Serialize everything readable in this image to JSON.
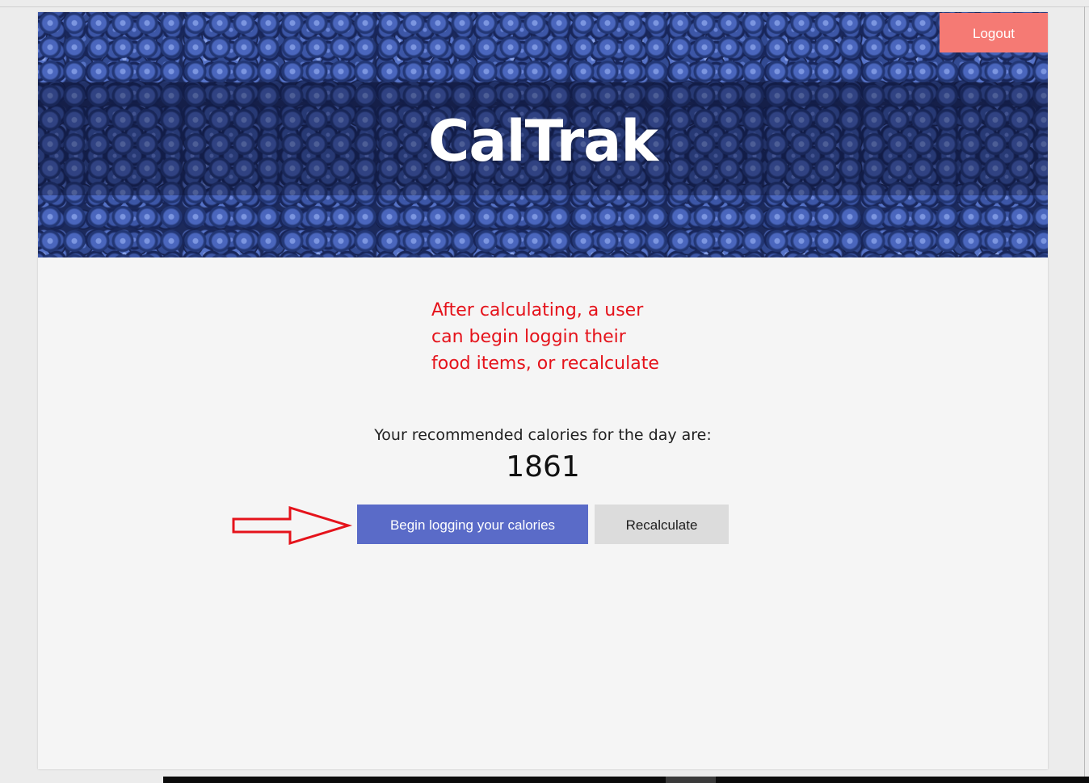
{
  "header": {
    "title": "CalTrak",
    "logout_label": "Logout"
  },
  "annotation": {
    "lines": [
      "After calculating, a user",
      "can begin loggin their",
      "food items, or recalculate"
    ],
    "color": "#e5131b"
  },
  "main": {
    "recommended_label": "Your recommended calories for the day are:",
    "recommended_value": "1861",
    "begin_label": "Begin logging your calories",
    "recalculate_label": "Recalculate"
  },
  "colors": {
    "logout": "#f57a74",
    "primary": "#5a6bc8",
    "secondary": "#dcdcdc",
    "page_bg": "#f5f5f5"
  }
}
